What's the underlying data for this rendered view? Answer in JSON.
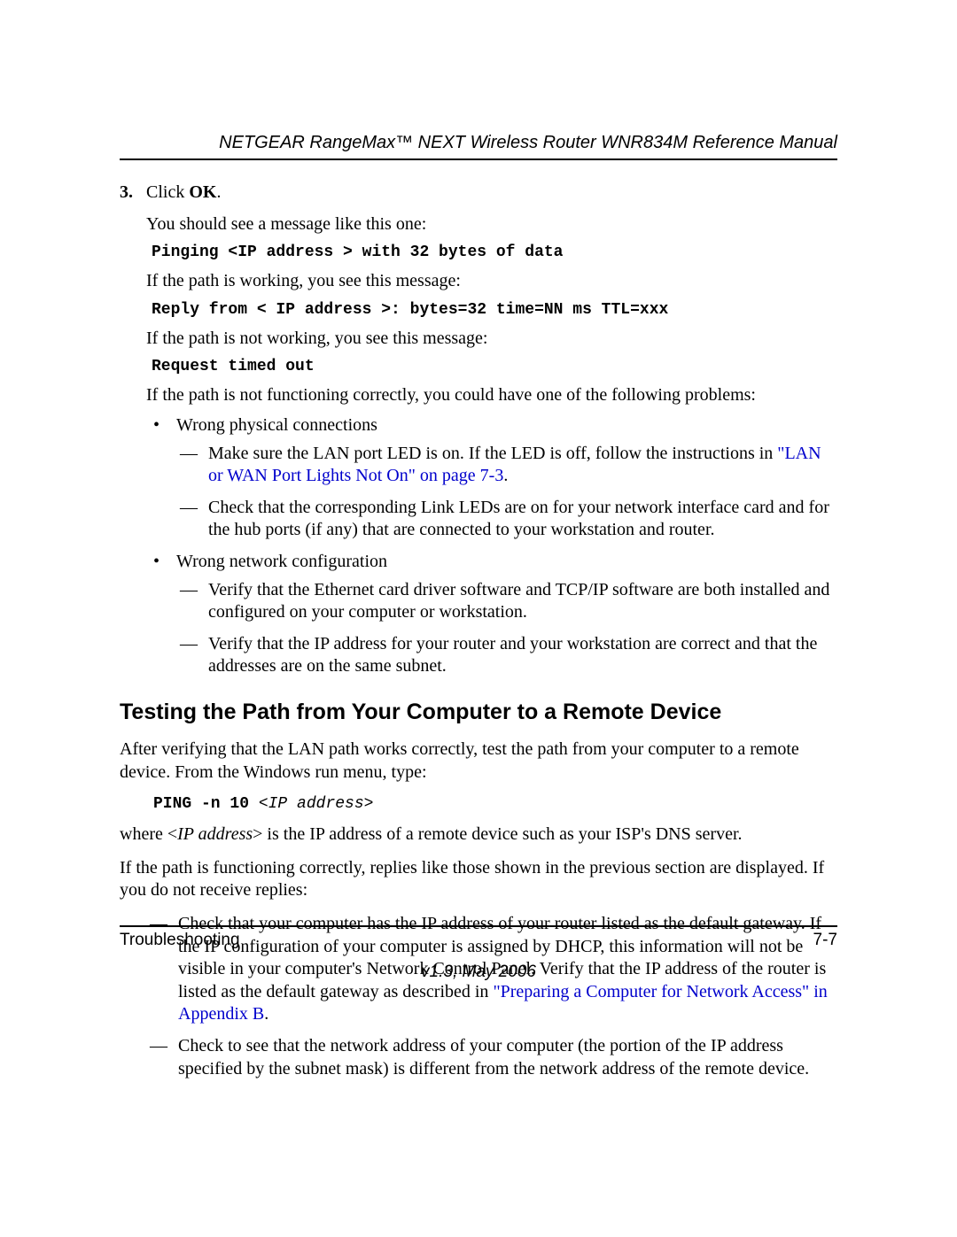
{
  "header": {
    "title": "NETGEAR RangeMax™ NEXT Wireless Router WNR834M Reference Manual"
  },
  "step": {
    "number": "3.",
    "click_pre": "Click ",
    "click_bold": "OK",
    "click_post": ".",
    "intro": "You should see a message like this one:",
    "ping_line": "Pinging <IP address > with 32 bytes of data",
    "working_intro": "If the path is working, you see this message:",
    "reply_line": "Reply from < IP address >: bytes=32 time=NN ms TTL=xxx",
    "notworking_intro": "If the path is not working, you see this message:",
    "timeout_line": "Request timed out",
    "problems_intro": "If the path is not functioning correctly, you could have one of the following problems:"
  },
  "bullets": {
    "b1": {
      "title": "Wrong physical connections",
      "d1_pre": "Make sure the LAN port LED is on. If the LED is off, follow the instructions in ",
      "d1_link": "\"LAN or WAN Port Lights Not On\" on page 7-3",
      "d1_post": ".",
      "d2": "Check that the corresponding Link LEDs are on for your network interface card and for the hub ports (if any) that are connected to your workstation and router."
    },
    "b2": {
      "title": "Wrong network configuration",
      "d1": "Verify that the Ethernet card driver software and TCP/IP software are both installed and configured on your computer or workstation.",
      "d2": "Verify that the IP address for your router and your workstation are correct and that the addresses are on the same subnet."
    }
  },
  "section": {
    "heading": "Testing the Path from Your Computer to a Remote Device",
    "p1": "After verifying that the LAN path works correctly, test the path from your computer to a remote device. From the Windows run menu, type:",
    "cmd_pre": "PING -n 10 ",
    "cmd_arg": "<IP address>",
    "p2_pre": "where <",
    "p2_ital": "IP address",
    "p2_post": "> is the IP address of a remote device such as your ISP's DNS server.",
    "p3": "If the path is functioning correctly, replies like those shown in the previous section are displayed. If you do not receive replies:",
    "d1_pre": "Check that your computer has the IP address of your router listed as the default gateway. If the IP configuration of your computer is assigned by DHCP, this information will not be visible in your computer's Network Control Panel. Verify that the IP address of the router is listed as the default gateway as described in ",
    "d1_link": "\"Preparing a Computer for Network Access\" in Appendix B",
    "d1_post": ".",
    "d2": "Check to see that the network address of your computer (the portion of the IP address specified by the subnet mask) is different from the network address of the remote device."
  },
  "footer": {
    "left": "Troubleshooting",
    "right": "7-7",
    "version": "v1.3, May 2006"
  }
}
